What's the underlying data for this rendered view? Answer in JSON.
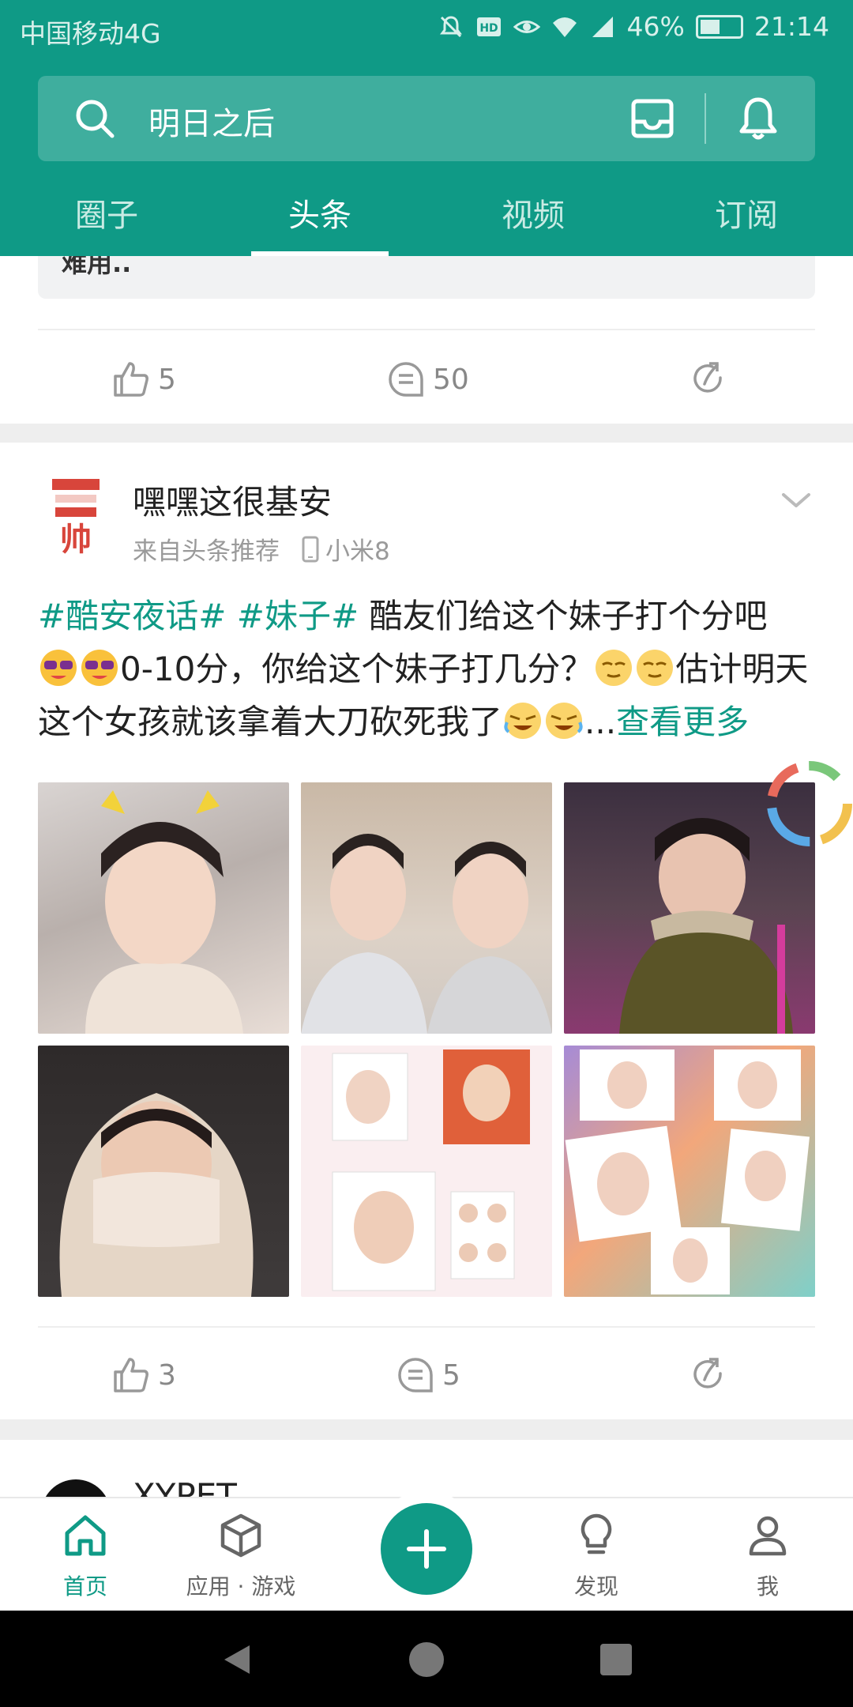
{
  "status_bar": {
    "carrier": "中国移动4G",
    "network": "4G",
    "battery": "46%",
    "time": "21:14"
  },
  "search": {
    "text": "明日之后"
  },
  "tabs": [
    {
      "label": "圈子"
    },
    {
      "label": "头条"
    },
    {
      "label": "视频"
    },
    {
      "label": "订阅"
    }
  ],
  "active_tab": "头条",
  "prev_post": {
    "quote_snippet": "难用..",
    "likes": "5",
    "comments": "50"
  },
  "post": {
    "avatar_text": "帅",
    "username": "嘿嘿这很基安",
    "source": "来自头条推荐",
    "device": "小米8",
    "tags": [
      "#酷安夜话#",
      "#妹子#"
    ],
    "text_part1": "酷友们给这个妹子打个分吧",
    "text_part2": "0-10分，你给这个妹子打几分？",
    "text_part3": "估计明天这个女孩就该拿着大刀砍死我了",
    "ellipsis": "...",
    "more_label": "查看更多",
    "likes": "3",
    "comments": "5",
    "image_count": 6
  },
  "next_post": {
    "username": "XYPET"
  },
  "bottom_nav": [
    {
      "label": "首页",
      "icon": "home-icon"
    },
    {
      "label": "应用 · 游戏",
      "icon": "cube-icon"
    },
    {
      "label": "发现",
      "icon": "lightbulb-icon"
    },
    {
      "label": "我",
      "icon": "person-icon"
    }
  ],
  "colors": {
    "accent": "#0f9a86",
    "header_bg": "#0f9a86"
  }
}
